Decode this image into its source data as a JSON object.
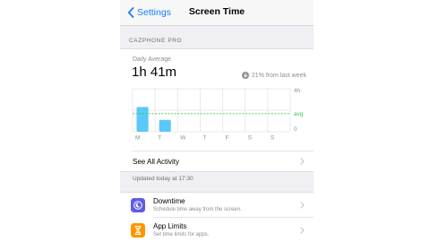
{
  "nav": {
    "back_label": "Settings",
    "title": "Screen Time"
  },
  "device": {
    "name": "CAZPHONE PRO"
  },
  "summary": {
    "daily_label": "Daily Average",
    "daily_value": "1h 41m",
    "change_text": "21% from last week"
  },
  "chart_data": {
    "type": "bar",
    "categories": [
      "M",
      "T",
      "W",
      "T",
      "F",
      "S",
      "S"
    ],
    "values": [
      2.3,
      1.1,
      0,
      0,
      0,
      0,
      0
    ],
    "ylim": [
      0,
      4
    ],
    "y_tick_labels": [
      "4h",
      "0"
    ],
    "average": 1.68,
    "average_label": "avg",
    "colors": {
      "bar": "#5ac8fa",
      "average": "#34c759",
      "grid": "#e5e5ea"
    }
  },
  "see_all": {
    "label": "See All Activity"
  },
  "updated": "Updated today at 17:30",
  "rows": [
    {
      "title": "Downtime",
      "subtitle": "Schedule time away from the screen.",
      "icon": "moon-icon",
      "color": "#5e5ce6"
    },
    {
      "title": "App Limits",
      "subtitle": "Set time limits for apps.",
      "icon": "hourglass-icon",
      "color": "#ff9500"
    }
  ]
}
